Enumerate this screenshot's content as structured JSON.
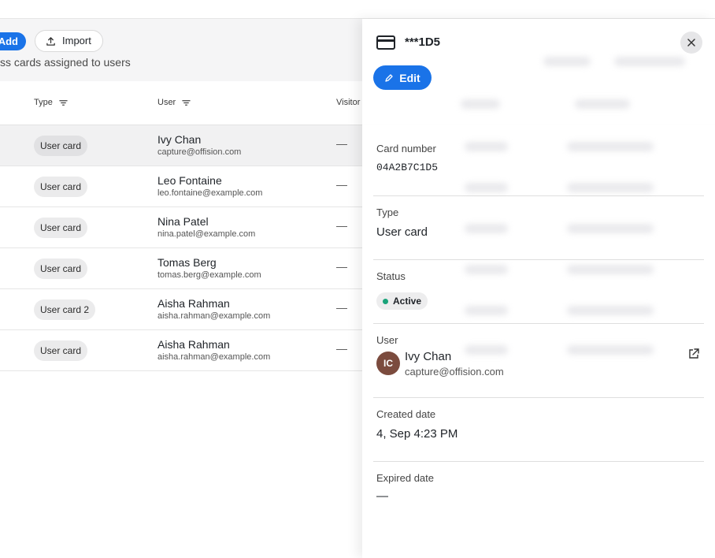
{
  "toolbar": {
    "add_label": "Add",
    "import_label": "Import",
    "subtitle": "ss cards assigned to users"
  },
  "table": {
    "headers": {
      "type": "Type",
      "user": "User",
      "visitor": "Visitor"
    },
    "rows": [
      {
        "type": "User card",
        "name": "Ivy Chan",
        "email": "capture@offision.com",
        "visitor": "—"
      },
      {
        "type": "User card",
        "name": "Leo Fontaine",
        "email": "leo.fontaine@example.com",
        "visitor": "—"
      },
      {
        "type": "User card",
        "name": "Nina Patel",
        "email": "nina.patel@example.com",
        "visitor": "—"
      },
      {
        "type": "User card",
        "name": "Tomas Berg",
        "email": "tomas.berg@example.com",
        "visitor": "—"
      },
      {
        "type": "User card 2",
        "name": "Aisha Rahman",
        "email": "aisha.rahman@example.com",
        "visitor": "—"
      },
      {
        "type": "User card",
        "name": "Aisha Rahman",
        "email": "aisha.rahman@example.com",
        "visitor": "—"
      }
    ]
  },
  "drawer": {
    "title": "***1D5",
    "edit_label": "Edit",
    "card_number_label": "Card number",
    "card_number_value": "04A2B7C1D5",
    "type_label": "Type",
    "type_value": "User card",
    "status_label": "Status",
    "status_value": "Active",
    "user_label": "User",
    "user_initials": "IC",
    "user_name": "Ivy Chan",
    "user_email": "capture@offision.com",
    "created_label": "Created date",
    "created_value": "4, Sep 4:23 PM",
    "expired_label": "Expired date",
    "expired_value": "—"
  },
  "colors": {
    "accent": "#1a73e8",
    "status_active": "#1aa37a",
    "avatar_bg": "#7b4b3e"
  },
  "icons": {
    "import": "upload-icon",
    "filter": "filter-icon",
    "card": "credit-card-icon",
    "close": "close-icon",
    "edit": "pencil-icon",
    "external": "external-link-icon"
  }
}
